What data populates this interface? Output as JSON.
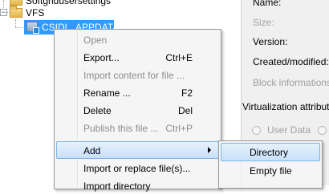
{
  "tree": {
    "items": [
      {
        "label": "Softgridusersettings"
      },
      {
        "label": "VFS"
      },
      {
        "label": "CSIDL_APPDATA",
        "selected": true
      }
    ]
  },
  "properties": {
    "name_label": "Name:",
    "size_label": "Size:",
    "version_label": "Version:",
    "created_label": "Created/modified:",
    "block_label": "Block informations",
    "virt_attr_label": "Virtualization attribut",
    "radio_user_data": "User Data"
  },
  "context_menu": {
    "items": [
      {
        "label": "Open",
        "shortcut": "",
        "disabled": true
      },
      {
        "label": "Export...",
        "shortcut": "Ctrl+E",
        "disabled": false
      },
      {
        "label": "Import content for file ...",
        "shortcut": "",
        "disabled": true
      },
      {
        "label": "Rename ...",
        "shortcut": "F2",
        "disabled": false
      },
      {
        "label": "Delete",
        "shortcut": "Del",
        "disabled": false
      },
      {
        "label": "Publish this file ...",
        "shortcut": "Ctrl+P",
        "disabled": true
      },
      {
        "label": "Add",
        "shortcut": "",
        "disabled": false,
        "highlighted": true,
        "submenu": true
      },
      {
        "label": "Import or replace file(s)...",
        "shortcut": "",
        "disabled": false
      },
      {
        "label": "Import directory",
        "shortcut": "",
        "disabled": false
      }
    ]
  },
  "submenu": {
    "items": [
      {
        "label": "Directory",
        "highlighted": true
      },
      {
        "label": "Empty file",
        "highlighted": false
      }
    ]
  },
  "colors": {
    "selection": "#3399ff",
    "menu_highlight": "#c9e0f8",
    "menu_highlight_border": "#7eb4ea"
  }
}
